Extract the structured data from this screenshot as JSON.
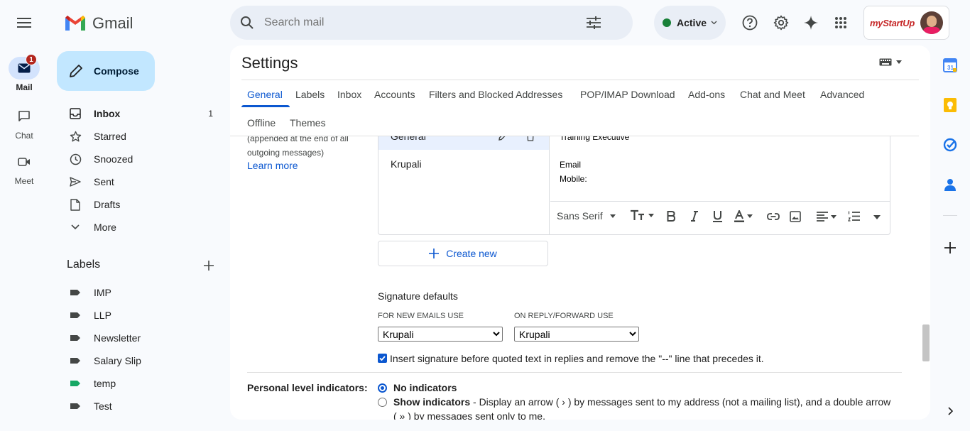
{
  "app": {
    "name": "Gmail",
    "logo_letter": "M"
  },
  "rail": {
    "mail": {
      "label": "Mail",
      "badge": "1"
    },
    "chat": {
      "label": "Chat"
    },
    "meet": {
      "label": "Meet"
    }
  },
  "compose_label": "Compose",
  "nav": [
    {
      "label": "Inbox",
      "count": "1",
      "icon": "inbox-icon"
    },
    {
      "label": "Starred",
      "icon": "star-icon"
    },
    {
      "label": "Snoozed",
      "icon": "clock-icon"
    },
    {
      "label": "Sent",
      "icon": "send-icon"
    },
    {
      "label": "Drafts",
      "icon": "draft-icon"
    },
    {
      "label": "More",
      "icon": "chevron-down-icon"
    }
  ],
  "labels_heading": "Labels",
  "labels": [
    {
      "name": "IMP",
      "color": "#444746"
    },
    {
      "name": "LLP",
      "color": "#444746"
    },
    {
      "name": "Newsletter",
      "color": "#444746"
    },
    {
      "name": "Salary Slip",
      "color": "#444746"
    },
    {
      "name": "temp",
      "color": "#16a765"
    },
    {
      "name": "Test",
      "color": "#444746"
    }
  ],
  "search": {
    "placeholder": "Search mail"
  },
  "status": {
    "label": "Active",
    "color": "#188038"
  },
  "account_logo_text": "myStartUp",
  "settings": {
    "title": "Settings",
    "tabs": [
      "General",
      "Labels",
      "Inbox",
      "Accounts",
      "Filters and Blocked Addresses",
      "POP/IMAP Download",
      "Add-ons",
      "Chat and Meet",
      "Advanced",
      "Offline",
      "Themes"
    ],
    "active_tab": "General",
    "signature": {
      "desc_line1": "(appended at the end of all",
      "desc_line2": "outgoing messages)",
      "learn_more": "Learn more",
      "list": [
        "General",
        "Krupali"
      ],
      "editor_lines": [
        "Training Executive",
        "",
        "Email",
        "Mobile:"
      ],
      "font": "Sans Serif",
      "create_new": "Create new",
      "defaults_heading": "Signature defaults",
      "new_emails_label": "FOR NEW EMAILS USE",
      "new_emails_value": "Krupali",
      "reply_label": "ON REPLY/FORWARD USE",
      "reply_value": "Krupali",
      "insert_before_quoted": "Insert signature before quoted text in replies and remove the \"--\" line that precedes it.",
      "insert_before_quoted_checked": true
    },
    "personal_indicators": {
      "label": "Personal level indicators:",
      "opt1": "No indicators",
      "opt2_bold": "Show indicators",
      "opt2_text": " - Display an arrow ( › ) by messages sent to my address (not a mailing list), and a double arrow",
      "opt2_line2": "( » ) by messages sent only to me.",
      "selected": "No indicators"
    }
  },
  "colors": {
    "accent": "#0b57d0",
    "compose_bg": "#c2e7ff",
    "panel_bg": "#ffffff",
    "page_bg": "#f8fafd"
  }
}
